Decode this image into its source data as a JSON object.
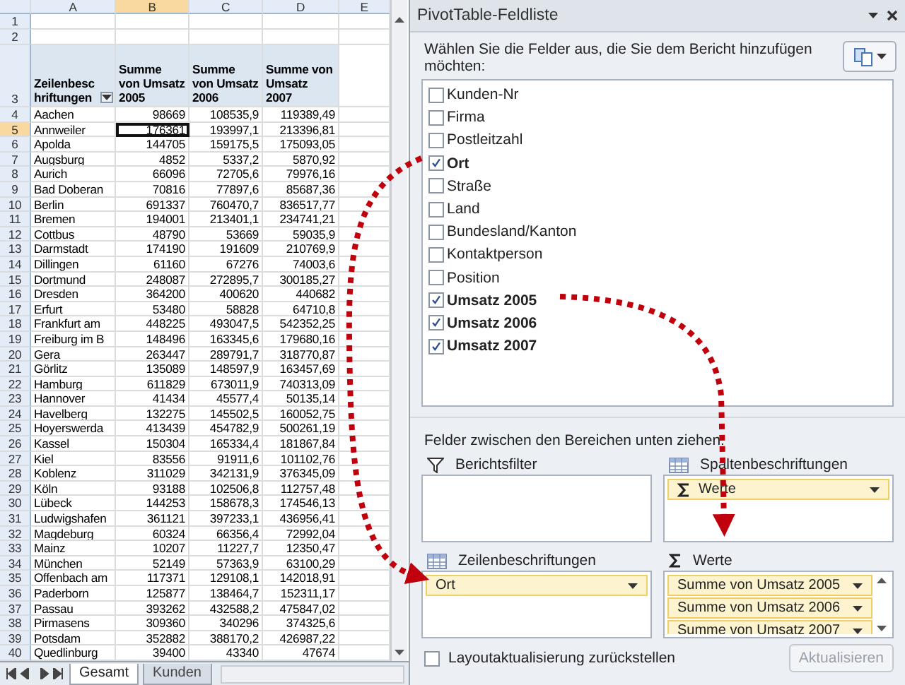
{
  "sheet": {
    "columns": [
      {
        "label": "A",
        "selected": false
      },
      {
        "label": "B",
        "selected": true
      },
      {
        "label": "C",
        "selected": false
      },
      {
        "label": "D",
        "selected": false
      },
      {
        "label": "E",
        "selected": false
      }
    ],
    "empty_rows": [
      {
        "number": "1",
        "selected": false
      },
      {
        "number": "2",
        "selected": false
      }
    ],
    "header_row": {
      "number": "3",
      "selected": false,
      "cells": [
        "Zeilenbeschriftungen",
        "Summe von Umsatz 2005",
        "Summe von Umsatz 2006",
        "Summe von Umsatz 2007"
      ]
    },
    "rows": [
      {
        "number": "4",
        "selected": false,
        "cells": [
          "Aachen",
          "98669",
          "108535,9",
          "119389,49"
        ]
      },
      {
        "number": "5",
        "selected": true,
        "cells": [
          "Annweiler",
          "176361",
          "193997,1",
          "213396,81"
        ]
      },
      {
        "number": "6",
        "selected": false,
        "cells": [
          "Apolda",
          "144705",
          "159175,5",
          "175093,05"
        ]
      },
      {
        "number": "7",
        "selected": false,
        "cells": [
          "Augsburg",
          "4852",
          "5337,2",
          "5870,92"
        ]
      },
      {
        "number": "8",
        "selected": false,
        "cells": [
          "Aurich",
          "66096",
          "72705,6",
          "79976,16"
        ]
      },
      {
        "number": "9",
        "selected": false,
        "cells": [
          "Bad Doberan",
          "70816",
          "77897,6",
          "85687,36"
        ]
      },
      {
        "number": "10",
        "selected": false,
        "cells": [
          "Berlin",
          "691337",
          "760470,7",
          "836517,77"
        ]
      },
      {
        "number": "11",
        "selected": false,
        "cells": [
          "Bremen",
          "194001",
          "213401,1",
          "234741,21"
        ]
      },
      {
        "number": "12",
        "selected": false,
        "cells": [
          "Cottbus",
          "48790",
          "53669",
          "59035,9"
        ]
      },
      {
        "number": "13",
        "selected": false,
        "cells": [
          "Darmstadt",
          "174190",
          "191609",
          "210769,9"
        ]
      },
      {
        "number": "14",
        "selected": false,
        "cells": [
          "Dillingen",
          "61160",
          "67276",
          "74003,6"
        ]
      },
      {
        "number": "15",
        "selected": false,
        "cells": [
          "Dortmund",
          "248087",
          "272895,7",
          "300185,27"
        ]
      },
      {
        "number": "16",
        "selected": false,
        "cells": [
          "Dresden",
          "364200",
          "400620",
          "440682"
        ]
      },
      {
        "number": "17",
        "selected": false,
        "cells": [
          "Erfurt",
          "53480",
          "58828",
          "64710,8"
        ]
      },
      {
        "number": "18",
        "selected": false,
        "cells": [
          "Frankfurt am",
          "448225",
          "493047,5",
          "542352,25"
        ]
      },
      {
        "number": "19",
        "selected": false,
        "cells": [
          "Freiburg im B",
          "148496",
          "163345,6",
          "179680,16"
        ]
      },
      {
        "number": "20",
        "selected": false,
        "cells": [
          "Gera",
          "263447",
          "289791,7",
          "318770,87"
        ]
      },
      {
        "number": "21",
        "selected": false,
        "cells": [
          "Görlitz",
          "135089",
          "148597,9",
          "163457,69"
        ]
      },
      {
        "number": "22",
        "selected": false,
        "cells": [
          "Hamburg",
          "611829",
          "673011,9",
          "740313,09"
        ]
      },
      {
        "number": "23",
        "selected": false,
        "cells": [
          "Hannover",
          "41434",
          "45577,4",
          "50135,14"
        ]
      },
      {
        "number": "24",
        "selected": false,
        "cells": [
          "Havelberg",
          "132275",
          "145502,5",
          "160052,75"
        ]
      },
      {
        "number": "25",
        "selected": false,
        "cells": [
          "Hoyerswerda",
          "413439",
          "454782,9",
          "500261,19"
        ]
      },
      {
        "number": "26",
        "selected": false,
        "cells": [
          "Kassel",
          "150304",
          "165334,4",
          "181867,84"
        ]
      },
      {
        "number": "27",
        "selected": false,
        "cells": [
          "Kiel",
          "83556",
          "91911,6",
          "101102,76"
        ]
      },
      {
        "number": "28",
        "selected": false,
        "cells": [
          "Koblenz",
          "311029",
          "342131,9",
          "376345,09"
        ]
      },
      {
        "number": "29",
        "selected": false,
        "cells": [
          "Köln",
          "93188",
          "102506,8",
          "112757,48"
        ]
      },
      {
        "number": "30",
        "selected": false,
        "cells": [
          "Lübeck",
          "144253",
          "158678,3",
          "174546,13"
        ]
      },
      {
        "number": "31",
        "selected": false,
        "cells": [
          "Ludwigshafen",
          "361121",
          "397233,1",
          "436956,41"
        ]
      },
      {
        "number": "32",
        "selected": false,
        "cells": [
          "Magdeburg",
          "60324",
          "66356,4",
          "72992,04"
        ]
      },
      {
        "number": "33",
        "selected": false,
        "cells": [
          "Mainz",
          "10207",
          "11227,7",
          "12350,47"
        ]
      },
      {
        "number": "34",
        "selected": false,
        "cells": [
          "München",
          "52149",
          "57363,9",
          "63100,29"
        ]
      },
      {
        "number": "35",
        "selected": false,
        "cells": [
          "Offenbach am",
          "117371",
          "129108,1",
          "142018,91"
        ]
      },
      {
        "number": "36",
        "selected": false,
        "cells": [
          "Paderborn",
          "125877",
          "138464,7",
          "152311,17"
        ]
      },
      {
        "number": "37",
        "selected": false,
        "cells": [
          "Passau",
          "393262",
          "432588,2",
          "475847,02"
        ]
      },
      {
        "number": "38",
        "selected": false,
        "cells": [
          "Pirmasens",
          "309360",
          "340296",
          "374325,6"
        ]
      },
      {
        "number": "39",
        "selected": false,
        "cells": [
          "Potsdam",
          "352882",
          "388170,2",
          "426987,22"
        ]
      },
      {
        "number": "40",
        "selected": false,
        "cells": [
          "Quedlinburg",
          "39400",
          "43340",
          "47674"
        ]
      }
    ],
    "sheet_tabs": [
      {
        "label": "Gesamt",
        "selected": true
      },
      {
        "label": "Kunden",
        "selected": false
      }
    ]
  },
  "panel": {
    "title": "PivotTable-Feldliste",
    "instruction": "Wählen Sie die Felder aus, die Sie dem Bericht hinzufügen möchten:",
    "fields": [
      {
        "label": "Kunden-Nr",
        "checked": false
      },
      {
        "label": "Firma",
        "checked": false
      },
      {
        "label": "Postleitzahl",
        "checked": false
      },
      {
        "label": "Ort",
        "checked": true
      },
      {
        "label": "Straße",
        "checked": false
      },
      {
        "label": "Land",
        "checked": false
      },
      {
        "label": "Bundesland/Kanton",
        "checked": false
      },
      {
        "label": "Kontaktperson",
        "checked": false
      },
      {
        "label": "Position",
        "checked": false
      },
      {
        "label": "Umsatz 2005",
        "checked": true
      },
      {
        "label": "Umsatz 2006",
        "checked": true
      },
      {
        "label": "Umsatz 2007",
        "checked": true
      }
    ],
    "areas_hint": "Felder zwischen den Bereichen unten ziehen:",
    "areas": [
      {
        "title": "Berichtsfilter",
        "kind": "filter"
      },
      {
        "title": "Spaltenbeschriftungen",
        "kind": "columns",
        "items": [
          {
            "label": "Werte",
            "kind": "values"
          }
        ]
      },
      {
        "title": "Zeilenbeschriftungen",
        "kind": "rows",
        "items": [
          {
            "label": "Ort",
            "kind": "field"
          }
        ]
      },
      {
        "title": "Werte",
        "kind": "values",
        "items": [
          {
            "label": "Summe von Umsatz 2005",
            "kind": "field"
          },
          {
            "label": "Summe von Umsatz 2006",
            "kind": "field"
          },
          {
            "label": "Summe von Umsatz 2007",
            "kind": "field"
          }
        ]
      }
    ],
    "defer_update": {
      "label": "Layoutaktualisierung zurückstellen",
      "checked": false
    },
    "update_button": {
      "label": "Aktualisieren",
      "disabled": true
    }
  }
}
